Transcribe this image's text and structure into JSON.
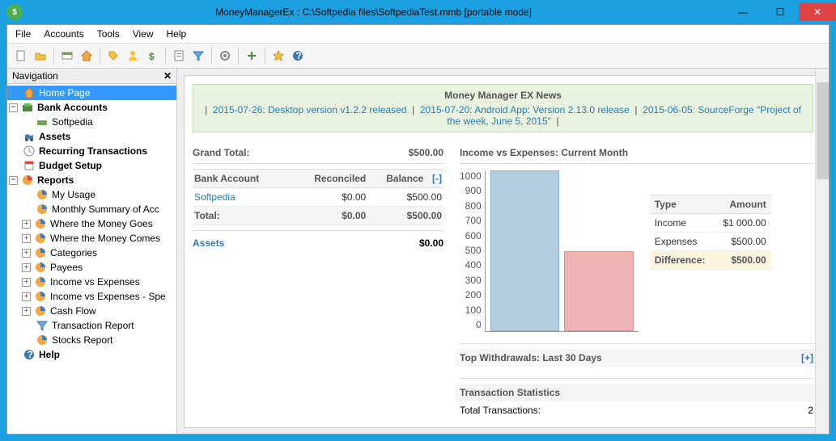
{
  "window": {
    "title": "MoneyManagerEx : C:\\Softpedia files\\SoftpediaTest.mmb [portable mode]"
  },
  "menu": {
    "file": "File",
    "accounts": "Accounts",
    "tools": "Tools",
    "view": "View",
    "help": "Help"
  },
  "nav": {
    "header": "Navigation",
    "home": "Home Page",
    "bank": "Bank Accounts",
    "softpedia": "Softpedia",
    "assets": "Assets",
    "recurring": "Recurring Transactions",
    "budget": "Budget Setup",
    "reports": "Reports",
    "usage": "My Usage",
    "monthly": "Monthly Summary of Acc",
    "where_goes": "Where the Money Goes",
    "where_comes": "Where the Money Comes",
    "categories": "Categories",
    "payees": "Payees",
    "ive": "Income vs Expenses",
    "ive_spe": "Income vs Expenses - Spe",
    "cashflow": "Cash Flow",
    "trep": "Transaction Report",
    "stocks": "Stocks Report",
    "help": "Help"
  },
  "news": {
    "title": "Money Manager EX News",
    "l1": "2015-07-26: Desktop version v1.2.2 released",
    "l2": "2015-07-20: Android App: Version 2.13.0 release",
    "l3": "2015-06-05: SourceForge \"Project of the week, June 5, 2015\""
  },
  "totals": {
    "grand_label": "Grand Total:",
    "grand_value": "$500.00"
  },
  "accounts": {
    "h1": "Bank Account",
    "h2": "Reconciled",
    "h3": "Balance",
    "h4": "[-]",
    "r_name": "Softpedia",
    "r_rec": "$0.00",
    "r_bal": "$500.00",
    "t_label": "Total:",
    "t_rec": "$0.00",
    "t_bal": "$500.00",
    "assets_label": "Assets",
    "assets_val": "$0.00"
  },
  "chart_title": "Income vs Expenses: Current Month",
  "chart_data": {
    "type": "bar",
    "categories": [
      "Income",
      "Expenses"
    ],
    "values": [
      1000,
      500
    ],
    "ylim": [
      0,
      1000
    ],
    "ticks": [
      "1000",
      "900",
      "800",
      "700",
      "600",
      "500",
      "400",
      "300",
      "200",
      "100",
      "0"
    ],
    "colors": [
      "#b2cde0",
      "#f0b4b4"
    ]
  },
  "legend": {
    "h1": "Type",
    "h2": "Amount",
    "income_l": "Income",
    "income_v": "$1 000.00",
    "exp_l": "Expenses",
    "exp_v": "$500.00",
    "diff_l": "Difference:",
    "diff_v": "$500.00"
  },
  "withdrawals": {
    "title": "Top Withdrawals: Last 30 Days",
    "toggle": "[+]"
  },
  "stats": {
    "title": "Transaction Statistics",
    "row_l": "Total Transactions:",
    "row_v": "2"
  }
}
